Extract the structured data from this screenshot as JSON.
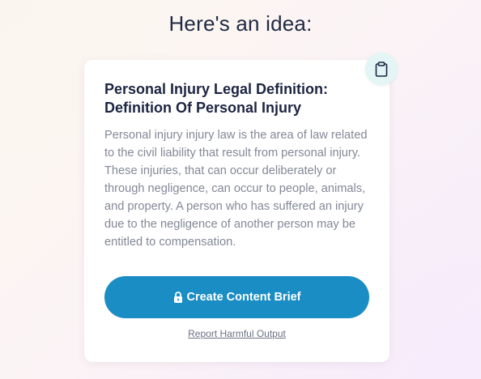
{
  "header": {
    "title": "Here's an idea:"
  },
  "card": {
    "title": "Personal Injury Legal Definition: Definition Of Personal Injury",
    "body": "Personal injury injury law is the area of law related to the civil liability that result from personal injury. These injuries, that can occur deliberately or through negligence, can occur to people, animals, and property. A person who has suffered an injury due to the negligence of another person may be entitled to compensation.",
    "copy_icon": "clipboard-icon",
    "cta_label": "Create Content Brief",
    "cta_icon": "lock-icon",
    "report_label": "Report Harmful Output"
  },
  "colors": {
    "accent": "#1a8dc4",
    "title_text": "#1c2541",
    "body_text": "#828897",
    "copy_button_bg": "#e3f6f5"
  }
}
